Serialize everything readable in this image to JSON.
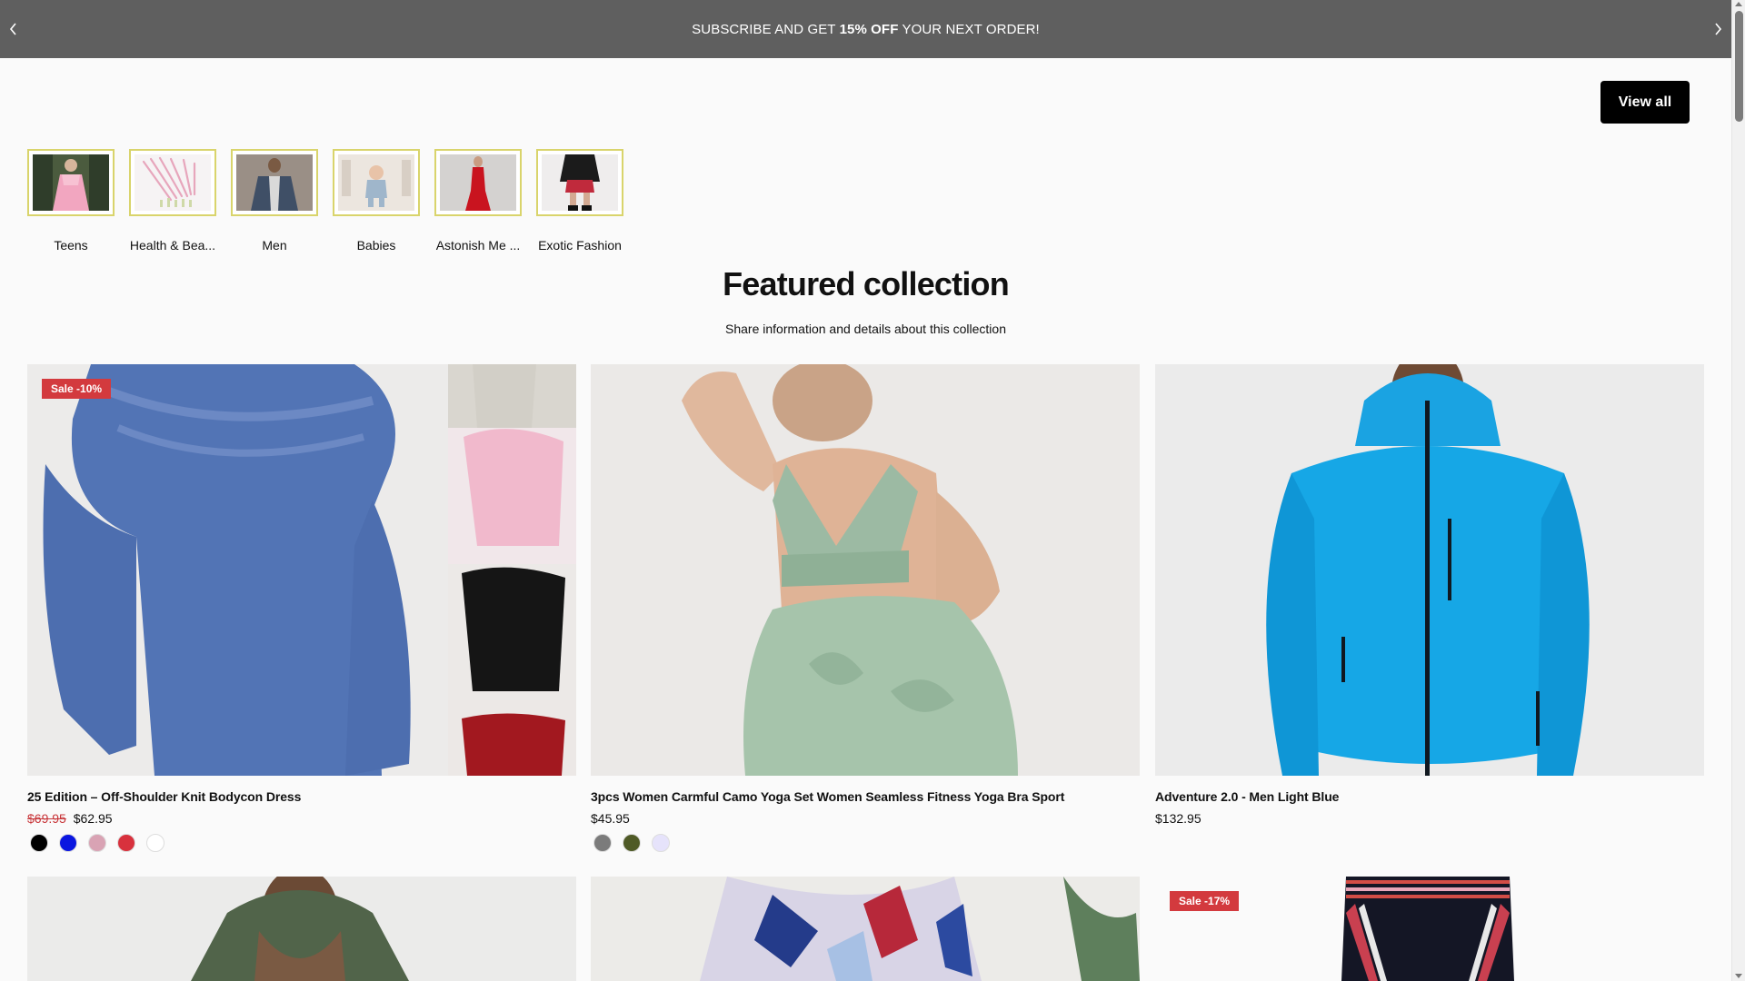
{
  "announcement": {
    "prefix": "SUBSCRIBE AND GET ",
    "highlight": "15% OFF",
    "suffix": " YOUR NEXT ORDER!",
    "prev_icon": "chevron-left-icon",
    "next_icon": "chevron-right-icon"
  },
  "view_all_label": "View all",
  "categories": [
    {
      "label": "Teens"
    },
    {
      "label": "Health & Bea..."
    },
    {
      "label": "Men"
    },
    {
      "label": "Babies"
    },
    {
      "label": "Astonish Me ..."
    },
    {
      "label": "Exotic Fashion"
    }
  ],
  "featured": {
    "title": "Featured collection",
    "subtitle": "Share information and details about this collection"
  },
  "products": [
    {
      "badge": "Sale -10%",
      "name": "25 Edition – Off-Shoulder Knit Bodycon Dress",
      "old_price": "$69.95",
      "price": "$62.95",
      "swatches": [
        "#000000",
        "#0a16e0",
        "#d9a3b4",
        "#d8313d",
        "#ffffff"
      ]
    },
    {
      "badge": "",
      "name": "3pcs Women Carmful Camo Yoga Set Women Seamless Fitness Yoga Bra Sport",
      "old_price": "",
      "price": "$45.95",
      "swatches": [
        "#7b7b7b",
        "#4f5a26",
        "#e6e3fb"
      ]
    },
    {
      "badge": "",
      "name": "Adventure 2.0 - Men Light Blue",
      "old_price": "",
      "price": "$132.95",
      "swatches": []
    },
    {
      "badge": ""
    },
    {
      "badge": ""
    },
    {
      "badge": "Sale -17%"
    }
  ]
}
